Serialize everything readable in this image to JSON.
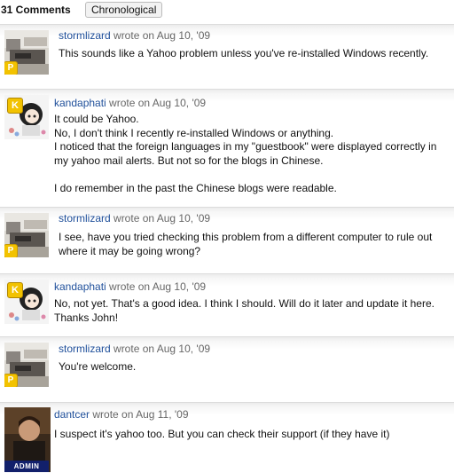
{
  "header": {
    "count_label": "31 Comments",
    "sort_label": "Chronological"
  },
  "comments": [
    {
      "author": "stormlizard",
      "meta": " wrote on Aug 10, '09",
      "avatar_badge": "P",
      "lines": [
        "This sounds like a Yahoo problem unless you've re-installed Windows recently."
      ]
    },
    {
      "author": "kandaphati",
      "meta": " wrote on Aug 10, '09",
      "avatar_badge": "K",
      "lines": [
        "It could be Yahoo.",
        "No, I don't think I recently re-installed Windows or anything.",
        "I noticed that the foreign languages in my \"guestbook\" were displayed correctly in",
        "my yahoo mail alerts. But not so for the blogs in Chinese.",
        "",
        "I do remember in the past the Chinese blogs were readable."
      ]
    },
    {
      "author": "stormlizard",
      "meta": " wrote on Aug 10, '09",
      "avatar_badge": "P",
      "lines": [
        "I see, have you tried checking this problem from a different computer to rule out",
        "where it may be going wrong?"
      ]
    },
    {
      "author": "kandaphati",
      "meta": " wrote on Aug 10, '09",
      "avatar_badge": "K",
      "lines": [
        "No, not yet. That's a good idea. I think I should. Will do it later and update it here.",
        "Thanks John!"
      ]
    },
    {
      "author": "stormlizard",
      "meta": " wrote on Aug 10, '09",
      "avatar_badge": "P",
      "lines": [
        "You're welcome."
      ]
    },
    {
      "author": "dantcer",
      "meta": " wrote on Aug 11, '09",
      "avatar_badge": "ADMIN",
      "lines": [
        "I suspect it's yahoo too. But you can check their support (if they have it)"
      ]
    }
  ]
}
